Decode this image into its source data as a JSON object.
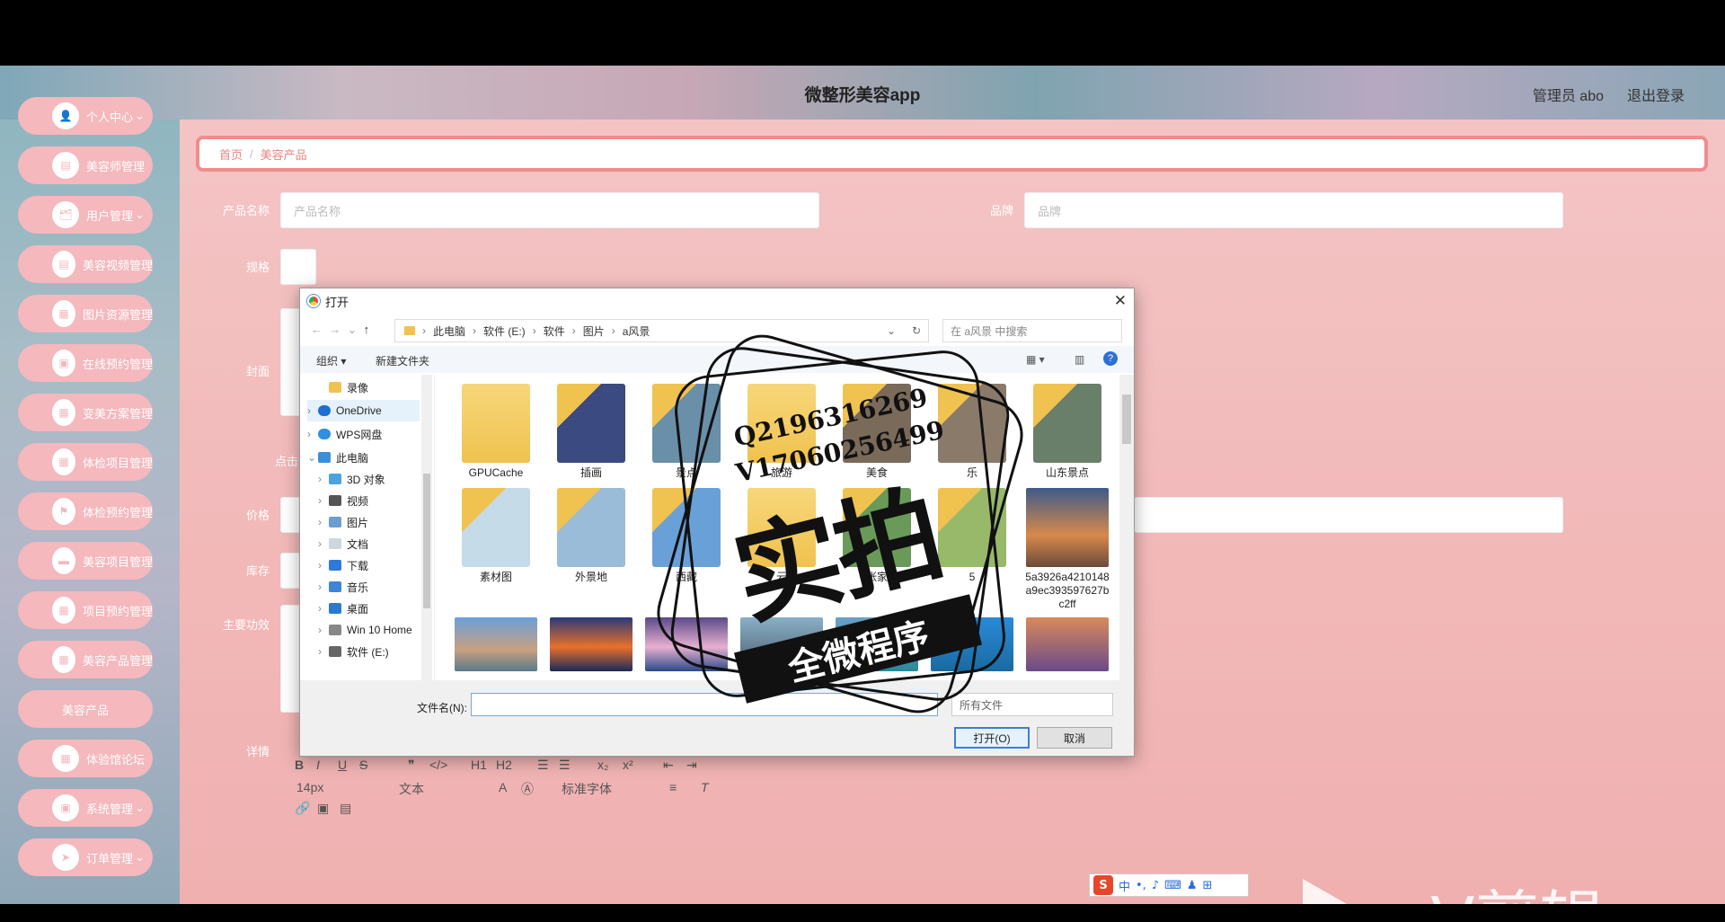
{
  "header": {
    "title": "微整形美容app",
    "admin": "管理员 abo",
    "logout": "退出登录"
  },
  "sidebar": {
    "items": [
      {
        "label": "个人中心",
        "dropdown": true
      },
      {
        "label": "美容师管理"
      },
      {
        "label": "用户管理",
        "dropdown": true
      },
      {
        "label": "美容视频管理"
      },
      {
        "label": "图片资源管理"
      },
      {
        "label": "在线预约管理"
      },
      {
        "label": "变美方案管理"
      },
      {
        "label": "体检项目管理"
      },
      {
        "label": "体检预约管理"
      },
      {
        "label": "美容项目管理"
      },
      {
        "label": "项目预约管理"
      },
      {
        "label": "美容产品管理"
      },
      {
        "label": "美容产品",
        "active": true
      },
      {
        "label": "体验馆论坛"
      },
      {
        "label": "系统管理",
        "dropdown": true
      },
      {
        "label": "订单管理",
        "dropdown": true
      }
    ]
  },
  "breadcrumb": {
    "home": "首页",
    "sep": "/",
    "current": "美容产品"
  },
  "form": {
    "name_label": "产品名称",
    "name_placeholder": "产品名称",
    "brand_label": "品牌",
    "brand_placeholder": "品牌",
    "spec_label": "规格",
    "cover_label": "封面",
    "cover_hint": "点击",
    "price_label": "价格",
    "stock_label": "库存",
    "effect_label": "主要功效",
    "detail_label": "详情"
  },
  "editor": {
    "font_size": "14px",
    "text_type": "文本",
    "font_family": "标准字体",
    "buttons": [
      "B",
      "I",
      "U",
      "S",
      "❞",
      "</>",
      "H1",
      "H2",
      "x₂",
      "x²"
    ]
  },
  "dialog": {
    "title": "打开",
    "path": [
      "此电脑",
      "软件 (E:)",
      "软件",
      "图片",
      "a风景"
    ],
    "search_placeholder": "在 a风景 中搜索",
    "organize": "组织 ▾",
    "new_folder": "新建文件夹",
    "nav": [
      "录像",
      "OneDrive",
      "WPS网盘",
      "此电脑",
      "3D 对象",
      "视频",
      "图片",
      "文档",
      "下载",
      "音乐",
      "桌面",
      "Win 10 Home",
      "软件 (E:)"
    ],
    "files_row1": [
      "GPUCache",
      "插画",
      "景点",
      "旅游",
      "美食",
      "乐",
      "山东景点"
    ],
    "files_row2": [
      "素材图",
      "外景地",
      "西藏",
      "云",
      "张家",
      "5",
      "5a3926a4210148a9ec393597627bc2ff"
    ],
    "filename_label": "文件名(N):",
    "filetype": "所有文件",
    "open_button": "打开(O)",
    "cancel_button": "取消"
  },
  "watermark": {
    "line1": "Q2196316269",
    "line2": "V17060256499",
    "big": "实拍",
    "ribbon": "全微程序",
    "ev": "eV剪辑"
  },
  "ime": {
    "mode": "中"
  },
  "colors": {
    "accent": "#f08c8c",
    "nav_bg": "#f4b8bd",
    "page_bg": "#f2b9b9"
  }
}
